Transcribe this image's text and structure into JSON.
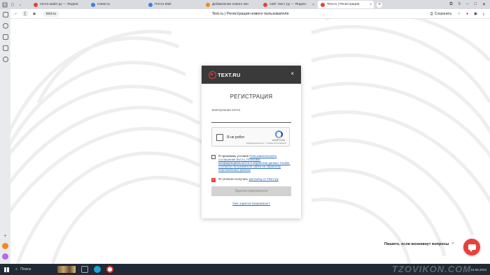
{
  "browser": {
    "tabs": [
      {
        "label": "почта майл ру — Яндекс",
        "color": "#e8403a"
      },
      {
        "label": "Новость",
        "color": "#3d7ee8"
      },
      {
        "label": "Почта Mail",
        "color": "#3d7ee8"
      },
      {
        "label": "Добавление нового окн",
        "color": "#f28a1a"
      },
      {
        "label": "сайт текст ру — Яндекс",
        "color": "#e8403a"
      },
      {
        "label": "Text.ru | Регистрация",
        "color": "#e8403a",
        "active": true
      }
    ],
    "url": "text.ru",
    "page_title": "Text.ru | Регистрация нового пользователя",
    "save_label": "Сохранить"
  },
  "modal": {
    "logo": "TEXT.RU",
    "close": "×",
    "title": "РЕГИСТРАЦИЯ",
    "email_label": "Электронная почта",
    "email_value": "",
    "captcha": {
      "label": "Я не робот",
      "brand": "reCAPTCHA",
      "links": "Конфиденциальность · Условия использования"
    },
    "terms": {
      "prefix": "Я принимаю условия ",
      "link": "Пользовательского соглашения text.ru, Политики конфиденциальности и обработки данных Cookie. Согласие пользователя сайта на обработку персональных данных",
      "checked": false
    },
    "newsletter": {
      "prefix": "Я согласен получать ",
      "link": "рассылку от Текст.ру",
      "checked": true
    },
    "register_button": "Зарегистрироваться",
    "already_link": "Уже зарегистрированы?"
  },
  "chat": {
    "hint": "Пишите, если возникнут вопросы",
    "close": "×"
  },
  "taskbar": {
    "search": "Поиск",
    "time": "16.06.2023"
  },
  "watermark": "TZOVIKON.COM",
  "colors": {
    "accent": "#e8403a",
    "modal_header": "#3a3a3a",
    "link": "#2b6cb0"
  }
}
